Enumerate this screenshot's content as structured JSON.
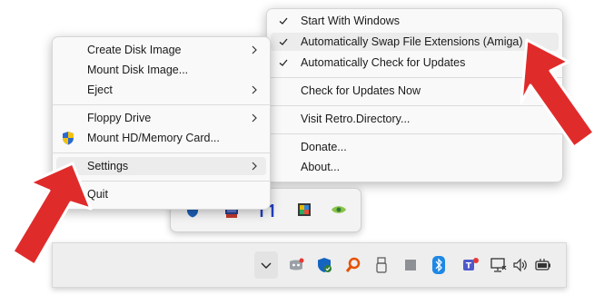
{
  "main_menu": {
    "items": [
      {
        "label": "Create Disk Image",
        "submenu": true
      },
      {
        "label": "Mount Disk Image...",
        "submenu": false
      },
      {
        "label": "Eject",
        "submenu": true
      },
      {
        "label": "Floppy Drive",
        "submenu": true
      },
      {
        "label": "Mount HD/Memory Card...",
        "submenu": false,
        "icon": "uac-shield-icon"
      },
      {
        "label": "Settings",
        "submenu": true,
        "highlighted": true
      },
      {
        "label": "Quit",
        "submenu": false
      }
    ]
  },
  "settings_menu": {
    "items": [
      {
        "label": "Start With Windows",
        "checked": true
      },
      {
        "label": "Automatically Swap File Extensions (Amiga)",
        "checked": true,
        "highlighted": true
      },
      {
        "label": "Automatically Check for Updates",
        "checked": true
      },
      {
        "label": "Check for Updates Now",
        "checked": false
      },
      {
        "label": "Visit Retro.Directory...",
        "checked": false
      },
      {
        "label": "Donate...",
        "checked": false
      },
      {
        "label": "About...",
        "checked": false
      }
    ]
  },
  "tray_popup": {
    "icons": [
      "shield-icon",
      "drawbridge-icon",
      "bracket-icon",
      "color-palette-icon",
      "eye-icon"
    ]
  },
  "taskbar": {
    "icons": [
      "chevron-up-icon",
      "discord-icon",
      "defender-icon",
      "search-key-icon",
      "usb-icon",
      "grey-square-icon",
      "bluetooth-icon",
      "teams-icon",
      "network-icon",
      "speaker-icon",
      "battery-icon"
    ]
  },
  "colors": {
    "arrow_red": "#e02b2b",
    "highlight": "#ececec",
    "menu_bg": "#f9f9f9"
  }
}
